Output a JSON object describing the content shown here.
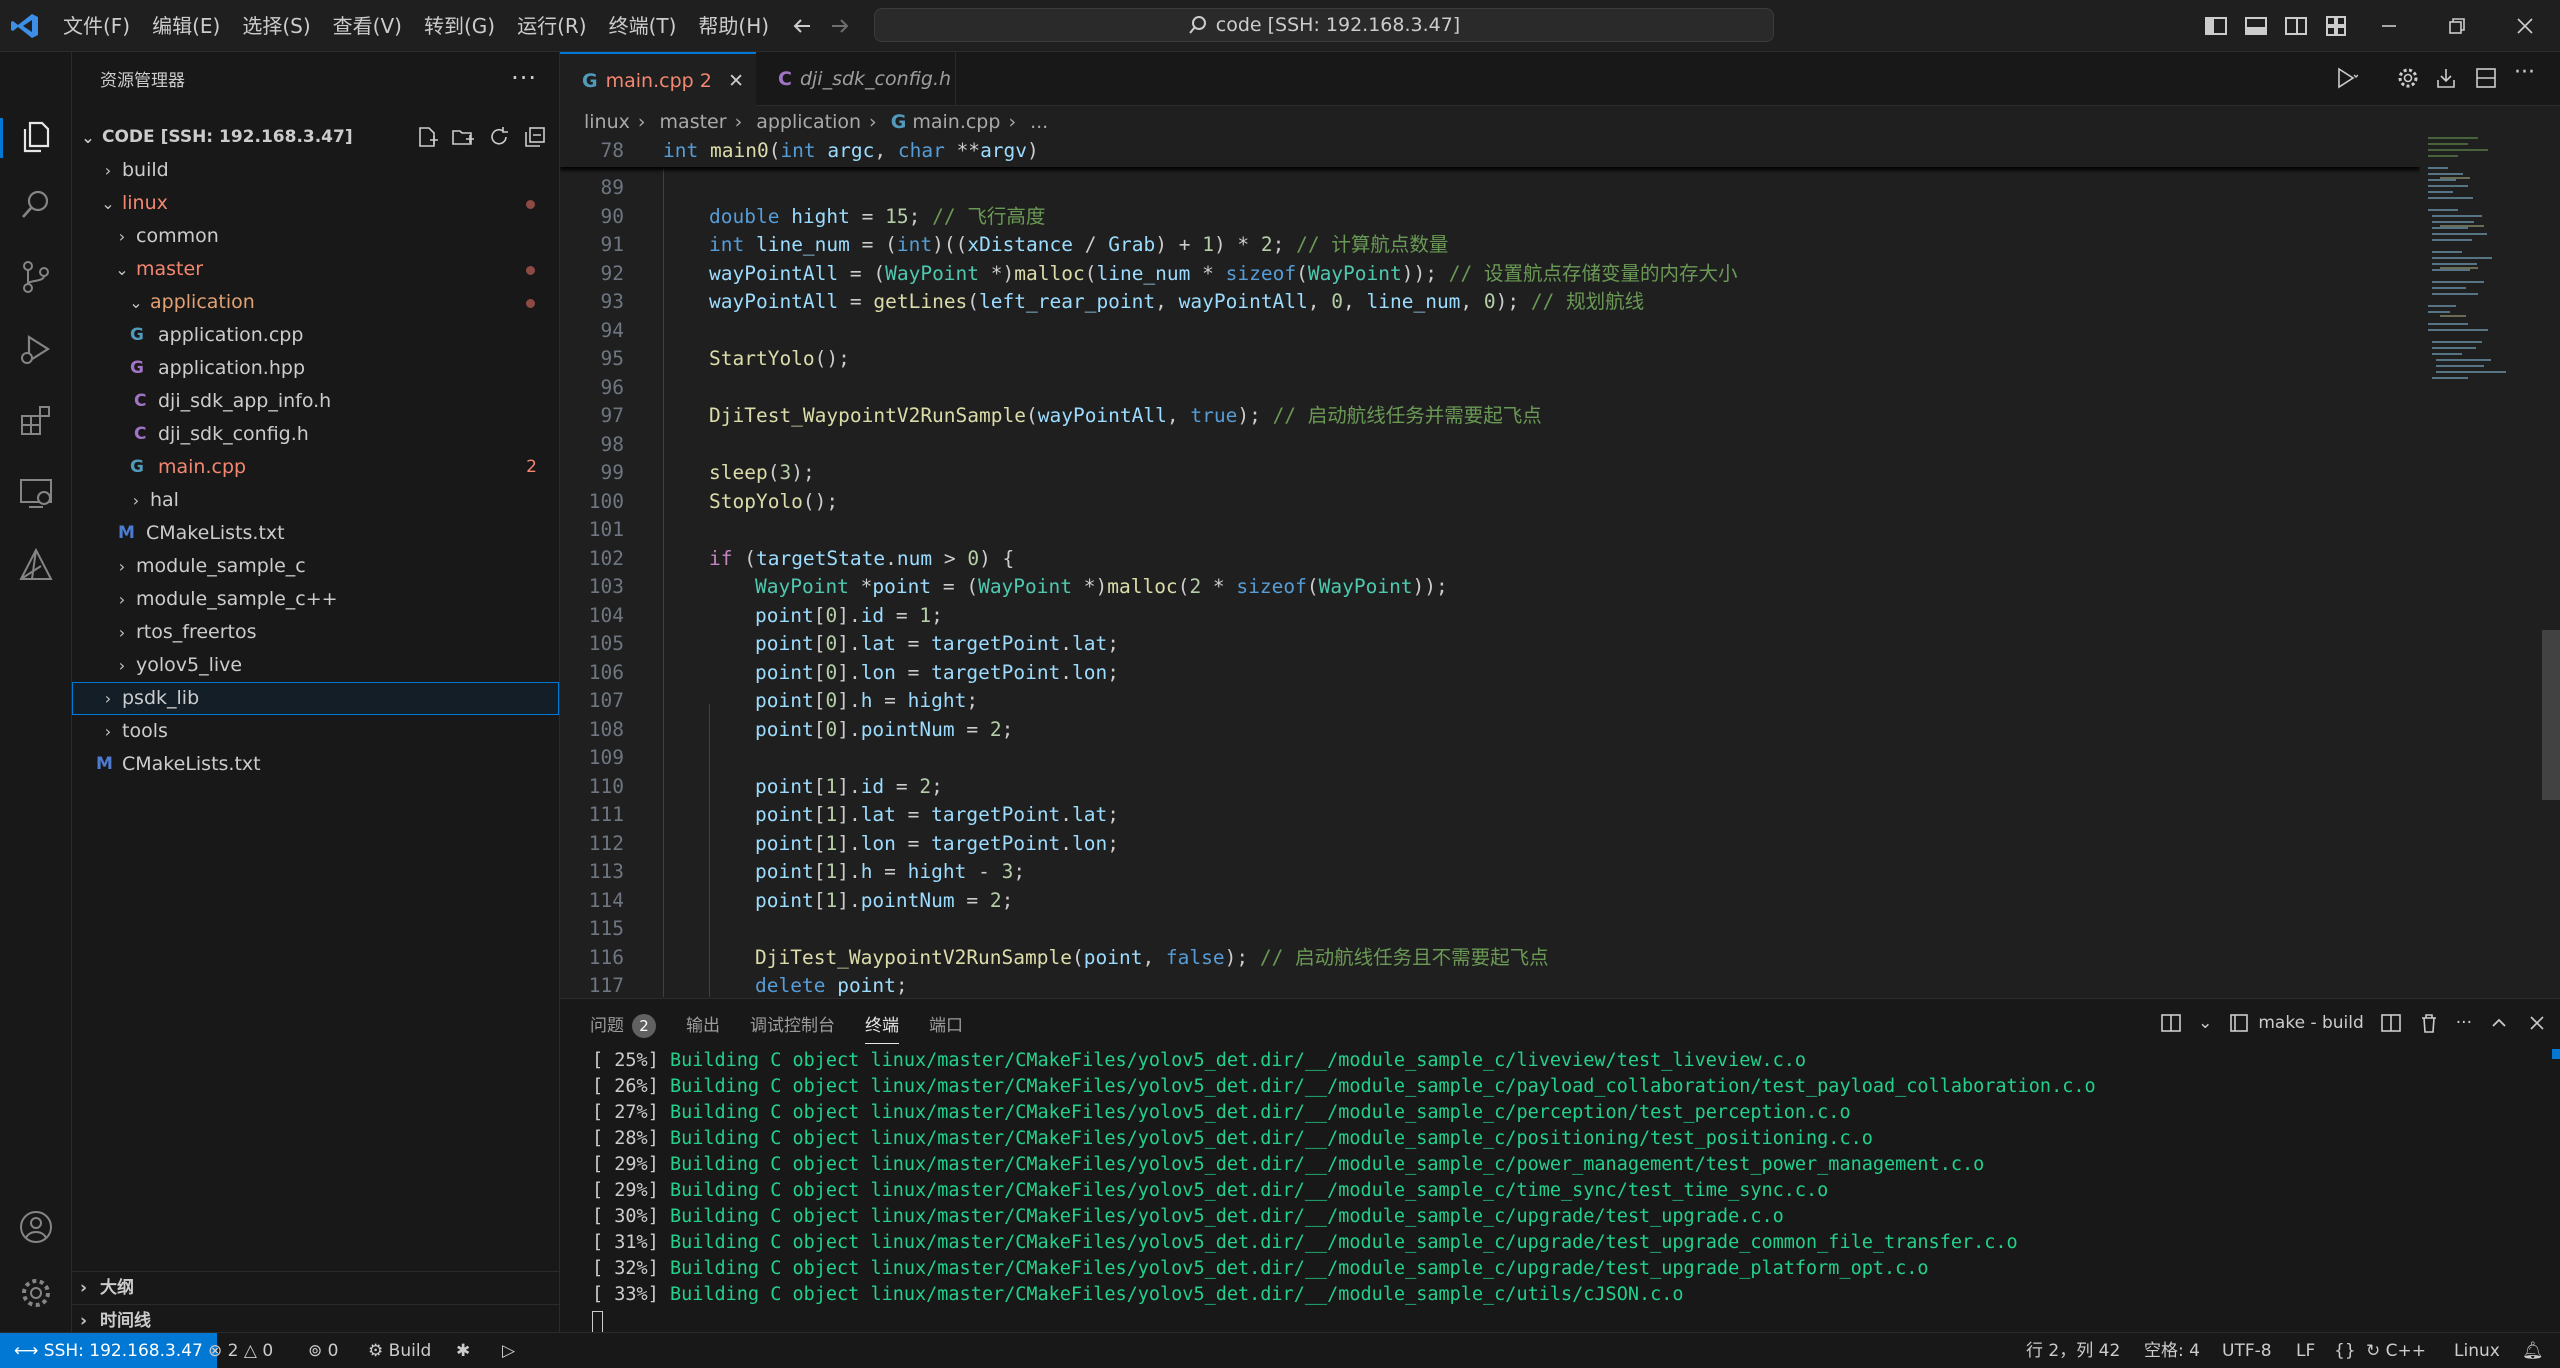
{
  "menu": [
    "文件(F)",
    "编辑(E)",
    "选择(S)",
    "查看(V)",
    "转到(G)",
    "运行(R)",
    "终端(T)",
    "帮助(H)"
  ],
  "command_center": "code [SSH: 192.168.3.47]",
  "sidebar": {
    "title": "资源管理器",
    "root": "CODE [SSH: 192.168.3.47]",
    "tree": [
      {
        "label": "build"
      },
      {
        "label": "linux"
      },
      {
        "label": "common"
      },
      {
        "label": "master"
      },
      {
        "label": "application"
      },
      {
        "label": "application.cpp",
        "icon": "G"
      },
      {
        "label": "application.hpp",
        "icon": "G"
      },
      {
        "label": "dji_sdk_app_info.h",
        "icon": "C"
      },
      {
        "label": "dji_sdk_config.h",
        "icon": "C"
      },
      {
        "label": "main.cpp",
        "icon": "G",
        "count": "2"
      },
      {
        "label": "hal"
      },
      {
        "label": "CMakeLists.txt",
        "icon": "M"
      },
      {
        "label": "module_sample_c"
      },
      {
        "label": "module_sample_c++"
      },
      {
        "label": "rtos_freertos"
      },
      {
        "label": "yolov5_live"
      },
      {
        "label": "psdk_lib"
      },
      {
        "label": "tools"
      },
      {
        "label": "CMakeLists.txt",
        "icon": "M"
      }
    ],
    "outline": "大纲",
    "timeline": "时间线"
  },
  "tabs": [
    {
      "label": "main.cpp",
      "badge": "2",
      "icon": "G"
    },
    {
      "label": "dji_sdk_config.h",
      "icon": "C"
    }
  ],
  "breadcrumb": {
    "p1": "linux",
    "p2": "master",
    "p3": "application",
    "p4": "main.cpp",
    "p5": "..."
  },
  "sticky": {
    "num": "78"
  },
  "code_lines": [
    {
      "n": "89"
    },
    {
      "n": "90"
    },
    {
      "n": "91"
    },
    {
      "n": "92"
    },
    {
      "n": "93"
    },
    {
      "n": "94"
    },
    {
      "n": "95"
    },
    {
      "n": "96"
    },
    {
      "n": "97"
    },
    {
      "n": "98"
    },
    {
      "n": "99"
    },
    {
      "n": "100"
    },
    {
      "n": "101"
    },
    {
      "n": "102"
    },
    {
      "n": "103"
    },
    {
      "n": "104"
    },
    {
      "n": "105"
    },
    {
      "n": "106"
    },
    {
      "n": "107"
    },
    {
      "n": "108"
    },
    {
      "n": "109"
    },
    {
      "n": "110"
    },
    {
      "n": "111"
    },
    {
      "n": "112"
    },
    {
      "n": "113"
    },
    {
      "n": "114"
    },
    {
      "n": "115"
    },
    {
      "n": "116"
    },
    {
      "n": "117"
    }
  ],
  "code_text": {
    "sticky": {
      "a": "int",
      "b": "main0",
      "c": "(",
      "d": "int",
      "e": " argc",
      "f": ", ",
      "g": "char",
      "h": " **",
      "i": "argv",
      "j": ")"
    },
    "l90": {
      "a": "double",
      "b": " hight",
      "c": " = ",
      "d": "15",
      "e": "; ",
      "f": "// 飞行高度"
    },
    "l91": {
      "a": "int",
      "b": " line_num",
      "c": " = (",
      "d": "int",
      "e": ")((",
      "f": "xDistance",
      "g": " / ",
      "h": "Grab",
      "i": ") + ",
      "j": "1",
      "k": ") * ",
      "l": "2",
      "m": "; ",
      "n": "// 计算航点数量"
    },
    "l92": {
      "a": "wayPointAll",
      "b": " = (",
      "c": "WayPoint",
      "d": " *)",
      "e": "malloc",
      "f": "(",
      "g": "line_num",
      "h": " * ",
      "i": "sizeof",
      "j": "(",
      "k": "WayPoint",
      "l": ")); ",
      "m": "// 设置航点存储变量的内存大小"
    },
    "l93": {
      "a": "wayPointAll",
      "b": " = ",
      "c": "getLines",
      "d": "(",
      "e": "left_rear_point",
      "f": ", ",
      "g": "wayPointAll",
      "h": ", ",
      "i": "0",
      "j": ", ",
      "k": "line_num",
      "l": ", ",
      "m": "0",
      "n": "); ",
      "o": "// 规划航线"
    },
    "l95": {
      "a": "StartYolo",
      "b": "();"
    },
    "l97": {
      "a": "DjiTest_WaypointV2RunSample",
      "b": "(",
      "c": "wayPointAll",
      "d": ", ",
      "e": "true",
      "f": "); ",
      "g": "// 启动航线任务并需要起飞点"
    },
    "l99": {
      "a": "sleep",
      "b": "(",
      "c": "3",
      "d": ");"
    },
    "l100": {
      "a": "StopYolo",
      "b": "();"
    },
    "l102": {
      "a": "if",
      "b": " (",
      "c": "targetState",
      "d": ".",
      "e": "num",
      "f": " > ",
      "g": "0",
      "h": ") {"
    },
    "l103": {
      "a": "WayPoint",
      "b": " *",
      "c": "point",
      "d": " = (",
      "e": "WayPoint",
      "f": " *)",
      "g": "malloc",
      "h": "(",
      "i": "2",
      "j": " * ",
      "k": "sizeof",
      "l": "(",
      "m": "WayPoint",
      "n": "));"
    },
    "l104": {
      "a": "point",
      "b": "[",
      "c": "0",
      "d": "].",
      "e": "id",
      "f": " = ",
      "g": "1",
      "h": ";"
    },
    "l105": {
      "a": "point",
      "b": "[",
      "c": "0",
      "d": "].",
      "e": "lat",
      "f": " = ",
      "g": "targetPoint",
      "h": ".",
      "i": "lat",
      "j": ";"
    },
    "l106": {
      "a": "point",
      "b": "[",
      "c": "0",
      "d": "].",
      "e": "lon",
      "f": " = ",
      "g": "targetPoint",
      "h": ".",
      "i": "lon",
      "j": ";"
    },
    "l107": {
      "a": "point",
      "b": "[",
      "c": "0",
      "d": "].",
      "e": "h",
      "f": " = ",
      "g": "hight",
      "h": ";"
    },
    "l108": {
      "a": "point",
      "b": "[",
      "c": "0",
      "d": "].",
      "e": "pointNum",
      "f": " = ",
      "g": "2",
      "h": ";"
    },
    "l110": {
      "a": "point",
      "b": "[",
      "c": "1",
      "d": "].",
      "e": "id",
      "f": " = ",
      "g": "2",
      "h": ";"
    },
    "l111": {
      "a": "point",
      "b": "[",
      "c": "1",
      "d": "].",
      "e": "lat",
      "f": " = ",
      "g": "targetPoint",
      "h": ".",
      "i": "lat",
      "j": ";"
    },
    "l112": {
      "a": "point",
      "b": "[",
      "c": "1",
      "d": "].",
      "e": "lon",
      "f": " = ",
      "g": "targetPoint",
      "h": ".",
      "i": "lon",
      "j": ";"
    },
    "l113": {
      "a": "point",
      "b": "[",
      "c": "1",
      "d": "].",
      "e": "h",
      "f": " = ",
      "g": "hight",
      "h": " - ",
      "i": "3",
      "j": ";"
    },
    "l114": {
      "a": "point",
      "b": "[",
      "c": "1",
      "d": "].",
      "e": "pointNum",
      "f": " = ",
      "g": "2",
      "h": ";"
    },
    "l116": {
      "a": "DjiTest_WaypointV2RunSample",
      "b": "(",
      "c": "point",
      "d": ", ",
      "e": "false",
      "f": "); ",
      "g": "// 启动航线任务且不需要起飞点"
    },
    "l117": {
      "a": "delete",
      "b": " ",
      "c": "point",
      "d": ";"
    }
  },
  "panel": {
    "tabs": {
      "problems": "问题",
      "problems_count": "2",
      "output": "输出",
      "debug": "调试控制台",
      "terminal": "终端",
      "ports": "端口"
    },
    "task": "make - build"
  },
  "terminal": [
    {
      "pct": "[ 25%]",
      "msg": " Building C object linux/master/CMakeFiles/yolov5_det.dir/__/module_sample_c/liveview/test_liveview.c.o"
    },
    {
      "pct": "[ 26%]",
      "msg": " Building C object linux/master/CMakeFiles/yolov5_det.dir/__/module_sample_c/payload_collaboration/test_payload_collaboration.c.o"
    },
    {
      "pct": "[ 27%]",
      "msg": " Building C object linux/master/CMakeFiles/yolov5_det.dir/__/module_sample_c/perception/test_perception.c.o"
    },
    {
      "pct": "[ 28%]",
      "msg": " Building C object linux/master/CMakeFiles/yolov5_det.dir/__/module_sample_c/positioning/test_positioning.c.o"
    },
    {
      "pct": "[ 29%]",
      "msg": " Building C object linux/master/CMakeFiles/yolov5_det.dir/__/module_sample_c/power_management/test_power_management.c.o"
    },
    {
      "pct": "[ 29%]",
      "msg": " Building C object linux/master/CMakeFiles/yolov5_det.dir/__/module_sample_c/time_sync/test_time_sync.c.o"
    },
    {
      "pct": "[ 30%]",
      "msg": " Building C object linux/master/CMakeFiles/yolov5_det.dir/__/module_sample_c/upgrade/test_upgrade.c.o"
    },
    {
      "pct": "[ 31%]",
      "msg": " Building C object linux/master/CMakeFiles/yolov5_det.dir/__/module_sample_c/upgrade/test_upgrade_common_file_transfer.c.o"
    },
    {
      "pct": "[ 32%]",
      "msg": " Building C object linux/master/CMakeFiles/yolov5_det.dir/__/module_sample_c/upgrade/test_upgrade_platform_opt.c.o"
    },
    {
      "pct": "[ 33%]",
      "msg": " Building C object linux/master/CMakeFiles/yolov5_det.dir/__/module_sample_c/utils/cJSON.c.o"
    }
  ],
  "statusbar": {
    "remote": "SSH: 192.168.3.47",
    "errors": "2",
    "warnings": "0",
    "ports": "0",
    "build": "Build",
    "position": "行 2，列 42",
    "spaces": "空格: 4",
    "encoding": "UTF-8",
    "eol": "LF",
    "braces": "{}",
    "language": "C++",
    "platform": "Linux"
  },
  "colors": {
    "accent": "#0078d4",
    "error": "#f48771",
    "term_green": "#23d18b"
  },
  "icons": [
    "vscode-logo",
    "explorer-icon",
    "search-icon",
    "source-control-icon",
    "run-debug-icon",
    "extensions-icon",
    "remote-explorer-icon",
    "cmake-icon",
    "account-icon",
    "settings-gear-icon"
  ]
}
